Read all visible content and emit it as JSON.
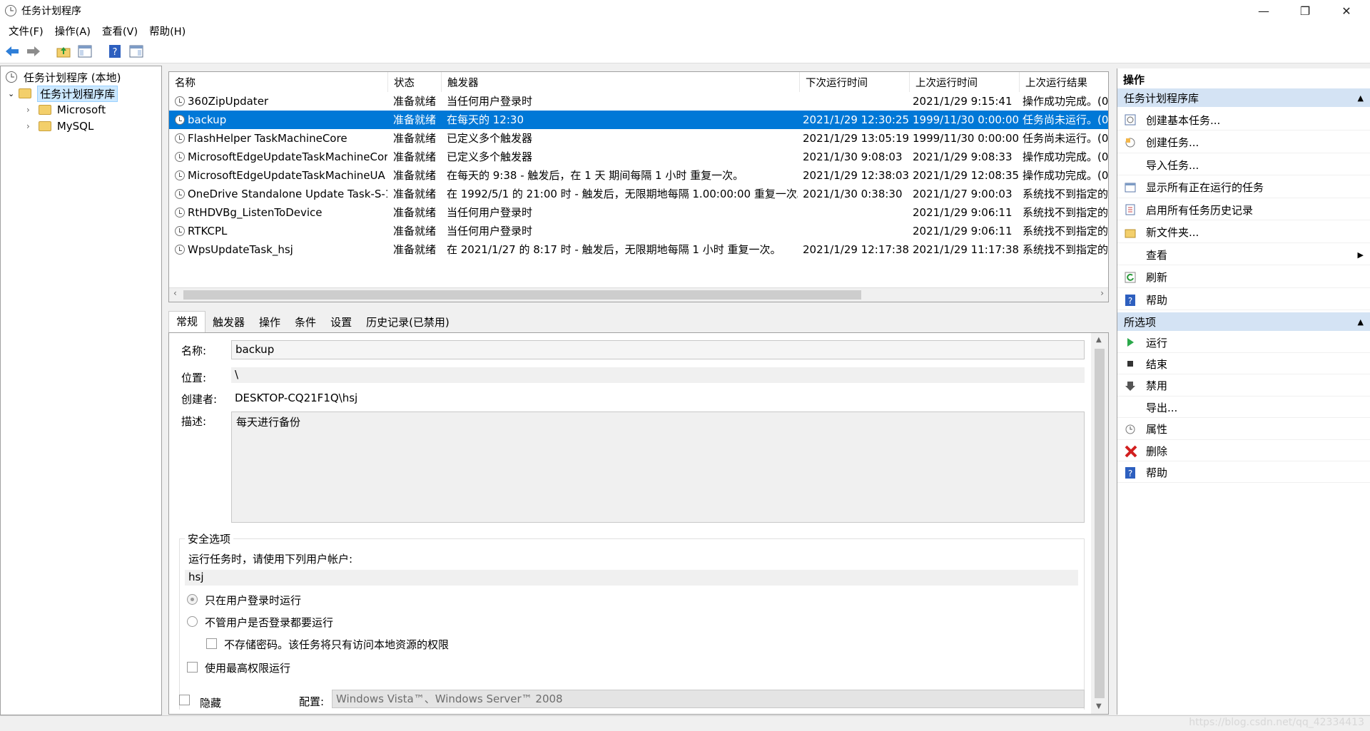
{
  "window": {
    "title": "任务计划程序"
  },
  "menu": {
    "file": "文件(F)",
    "action": "操作(A)",
    "view": "查看(V)",
    "help": "帮助(H)"
  },
  "tree": {
    "root": "任务计划程序 (本地)",
    "library": "任务计划程序库",
    "children": [
      "Microsoft",
      "MySQL"
    ]
  },
  "list": {
    "headers": [
      "名称",
      "状态",
      "触发器",
      "下次运行时间",
      "上次运行时间",
      "上次运行结果"
    ],
    "rows": [
      {
        "name": "360ZipUpdater",
        "status": "准备就绪",
        "trigger": "当任何用户登录时",
        "next": "",
        "last": "2021/1/29 9:15:41",
        "result": "操作成功完成。(0"
      },
      {
        "name": "backup",
        "status": "准备就绪",
        "trigger": "在每天的 12:30",
        "next": "2021/1/29 12:30:25",
        "last": "1999/11/30 0:00:00",
        "result": "任务尚未运行。(0"
      },
      {
        "name": "FlashHelper TaskMachineCore",
        "status": "准备就绪",
        "trigger": "已定义多个触发器",
        "next": "2021/1/29 13:05:19",
        "last": "1999/11/30 0:00:00",
        "result": "任务尚未运行。(0"
      },
      {
        "name": "MicrosoftEdgeUpdateTaskMachineCore",
        "status": "准备就绪",
        "trigger": "已定义多个触发器",
        "next": "2021/1/30 9:08:03",
        "last": "2021/1/29 9:08:33",
        "result": "操作成功完成。(0"
      },
      {
        "name": "MicrosoftEdgeUpdateTaskMachineUA",
        "status": "准备就绪",
        "trigger": "在每天的 9:38 - 触发后，在 1 天 期间每隔 1 小时 重复一次。",
        "next": "2021/1/29 12:38:03",
        "last": "2021/1/29 12:08:35",
        "result": "操作成功完成。(0"
      },
      {
        "name": "OneDrive Standalone Update Task-S-1...",
        "status": "准备就绪",
        "trigger": "在 1992/5/1 的 21:00 时 - 触发后，无限期地每隔 1.00:00:00 重复一次。",
        "next": "2021/1/30 0:38:30",
        "last": "2021/1/27 9:00:03",
        "result": "系统找不到指定的"
      },
      {
        "name": "RtHDVBg_ListenToDevice",
        "status": "准备就绪",
        "trigger": "当任何用户登录时",
        "next": "",
        "last": "2021/1/29 9:06:11",
        "result": "系统找不到指定的"
      },
      {
        "name": "RTKCPL",
        "status": "准备就绪",
        "trigger": "当任何用户登录时",
        "next": "",
        "last": "2021/1/29 9:06:11",
        "result": "系统找不到指定的"
      },
      {
        "name": "WpsUpdateTask_hsj",
        "status": "准备就绪",
        "trigger": "在 2021/1/27 的 8:17 时 - 触发后，无限期地每隔 1 小时 重复一次。",
        "next": "2021/1/29 12:17:38",
        "last": "2021/1/29 11:17:38",
        "result": "系统找不到指定的"
      }
    ]
  },
  "tabs": [
    "常规",
    "触发器",
    "操作",
    "条件",
    "设置",
    "历史记录(已禁用)"
  ],
  "general": {
    "name_label": "名称:",
    "name_value": "backup",
    "location_label": "位置:",
    "location_value": "\\",
    "author_label": "创建者:",
    "author_value": "DESKTOP-CQ21F1Q\\hsj",
    "desc_label": "描述:",
    "desc_value": "每天进行备份",
    "security_title": "安全选项",
    "run_as_label": "运行任务时，请使用下列用户帐户:",
    "user": "hsj",
    "opt_logged_on": "只在用户登录时运行",
    "opt_whether": "不管用户是否登录都要运行",
    "opt_nopass": "不存储密码。该任务将只有访问本地资源的权限",
    "opt_highest": "使用最高权限运行",
    "hidden": "隐藏",
    "config_label": "配置:",
    "config_value": "Windows Vista™、Windows Server™ 2008"
  },
  "actions": {
    "title": "操作",
    "section1": "任务计划程序库",
    "items1": [
      "创建基本任务...",
      "创建任务...",
      "导入任务...",
      "显示所有正在运行的任务",
      "启用所有任务历史记录",
      "新文件夹...",
      "查看",
      "刷新",
      "帮助"
    ],
    "section2": "所选项",
    "items2": [
      "运行",
      "结束",
      "禁用",
      "导出...",
      "属性",
      "删除",
      "帮助"
    ]
  },
  "watermark": "https://blog.csdn.net/qq_42334413"
}
